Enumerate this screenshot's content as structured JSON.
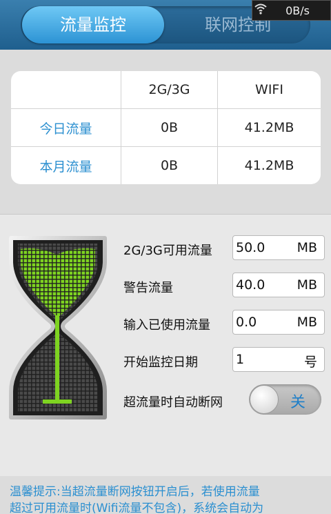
{
  "header": {
    "tabs": [
      {
        "label": "流量监控",
        "active": true
      },
      {
        "label": "联网控制",
        "active": false
      }
    ]
  },
  "status_overlay": {
    "wifi_icon": "wifi-icon",
    "rate": "0B/s"
  },
  "stats_table": {
    "columns": [
      "",
      "2G/3G",
      "WIFI"
    ],
    "rows": [
      {
        "label": "今日流量",
        "mobile": "0B",
        "wifi": "41.2MB"
      },
      {
        "label": "本月流量",
        "mobile": "0B",
        "wifi": "41.2MB"
      }
    ]
  },
  "settings": {
    "fields": [
      {
        "label": "2G/3G可用流量",
        "value": "50.0",
        "unit": "MB"
      },
      {
        "label": "警告流量",
        "value": "40.0",
        "unit": "MB"
      },
      {
        "label": "输入已使用流量",
        "value": "0.0",
        "unit": "MB"
      },
      {
        "label": "开始监控日期",
        "value": "1",
        "unit": "号"
      }
    ],
    "auto_disconnect": {
      "label": "超流量时自动断网",
      "state_label": "关",
      "on": false
    }
  },
  "tip": {
    "lines": [
      "温馨提示:当超流量断网按钮开启后，若使用流量",
      "超过可用流量时(Wifi流量不包含)，系统会自动为"
    ]
  },
  "colors": {
    "accent": "#2b8fd0",
    "header": "#1f5f8e",
    "hourglass_green": "#7ed321"
  }
}
